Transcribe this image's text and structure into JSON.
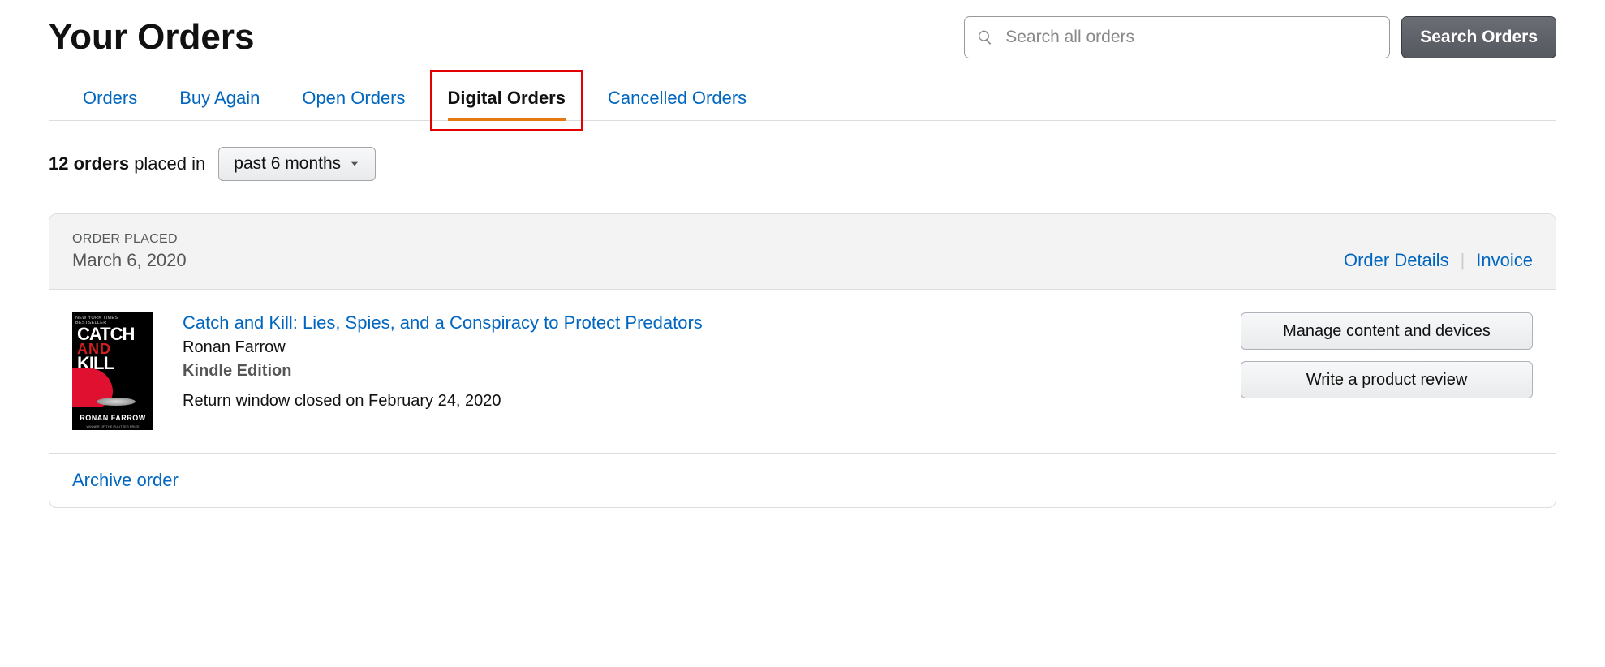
{
  "header": {
    "title": "Your Orders",
    "search_placeholder": "Search all orders",
    "search_button": "Search Orders"
  },
  "tabs": [
    {
      "label": "Orders",
      "active": false
    },
    {
      "label": "Buy Again",
      "active": false
    },
    {
      "label": "Open Orders",
      "active": false
    },
    {
      "label": "Digital Orders",
      "active": true
    },
    {
      "label": "Cancelled Orders",
      "active": false
    }
  ],
  "filter": {
    "count": "12 orders",
    "placed_in": "placed in",
    "range": "past 6 months"
  },
  "order": {
    "placed_label": "ORDER PLACED",
    "placed_date": "March 6, 2020",
    "links": {
      "details": "Order Details",
      "invoice": "Invoice"
    },
    "item": {
      "title": "Catch and Kill: Lies, Spies, and a Conspiracy to Protect Predators",
      "author": "Ronan Farrow",
      "format": "Kindle Edition",
      "return_note": "Return window closed on February 24, 2020",
      "cover": {
        "bestseller": "NEW YORK TIMES BESTSELLER",
        "t1": "CATCH",
        "t2": "AND",
        "t3": "KILL",
        "author_caps": "RONAN FARROW",
        "subline": "WINNER OF THE PULITZER PRIZE"
      }
    },
    "actions": {
      "manage": "Manage content and devices",
      "review": "Write a product review"
    },
    "archive": "Archive order"
  }
}
